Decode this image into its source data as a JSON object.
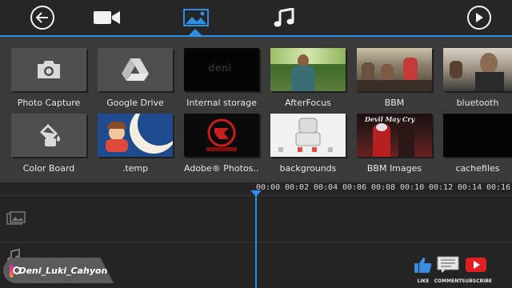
{
  "toolbar": {
    "back_label": "Back",
    "tabs": [
      {
        "name": "video",
        "icon": "video-camera-icon",
        "active": false
      },
      {
        "name": "image",
        "icon": "image-icon",
        "active": true
      },
      {
        "name": "music",
        "icon": "music-note-icon",
        "active": false
      }
    ],
    "play_label": "Play"
  },
  "media": {
    "row1": [
      {
        "label": "Photo Capture",
        "icon": "camera-icon"
      },
      {
        "label": "Google Drive",
        "icon": "google-drive-icon"
      },
      {
        "label": "Internal storage",
        "icon": "folder-thumbnail"
      },
      {
        "label": "AfterFocus",
        "icon": "folder-thumbnail"
      },
      {
        "label": "BBM",
        "icon": "folder-thumbnail"
      },
      {
        "label": "bluetooth",
        "icon": "folder-thumbnail"
      }
    ],
    "row2": [
      {
        "label": "Color Board",
        "icon": "paint-bucket-icon"
      },
      {
        "label": ".temp",
        "icon": "folder-thumbnail"
      },
      {
        "label": "Adobe® Photos…",
        "icon": "folder-thumbnail"
      },
      {
        "label": "backgrounds",
        "icon": "folder-thumbnail"
      },
      {
        "label": "BBM Images",
        "icon": "folder-thumbnail"
      },
      {
        "label": "cachefiles",
        "icon": "folder-thumbnail"
      }
    ],
    "thumb_texts": {
      "bbm_images_title": "Devil May Cry"
    }
  },
  "timeline": {
    "ticks": [
      "00:00",
      "00:02",
      "00:04",
      "00:06",
      "00:08",
      "00:10",
      "00:12",
      "00:14",
      "00:16"
    ]
  },
  "watermark": {
    "instagram_handle": "Deni_Luki_Cahyono",
    "like": "LIKE",
    "comment": "COMMENT",
    "subscribe": "SUBSCRIBE"
  },
  "colors": {
    "accent": "#2d8fe6",
    "toolbar_bg": "#262626",
    "grid_bg": "#3a3a3a",
    "timeline_bg": "#242424"
  }
}
